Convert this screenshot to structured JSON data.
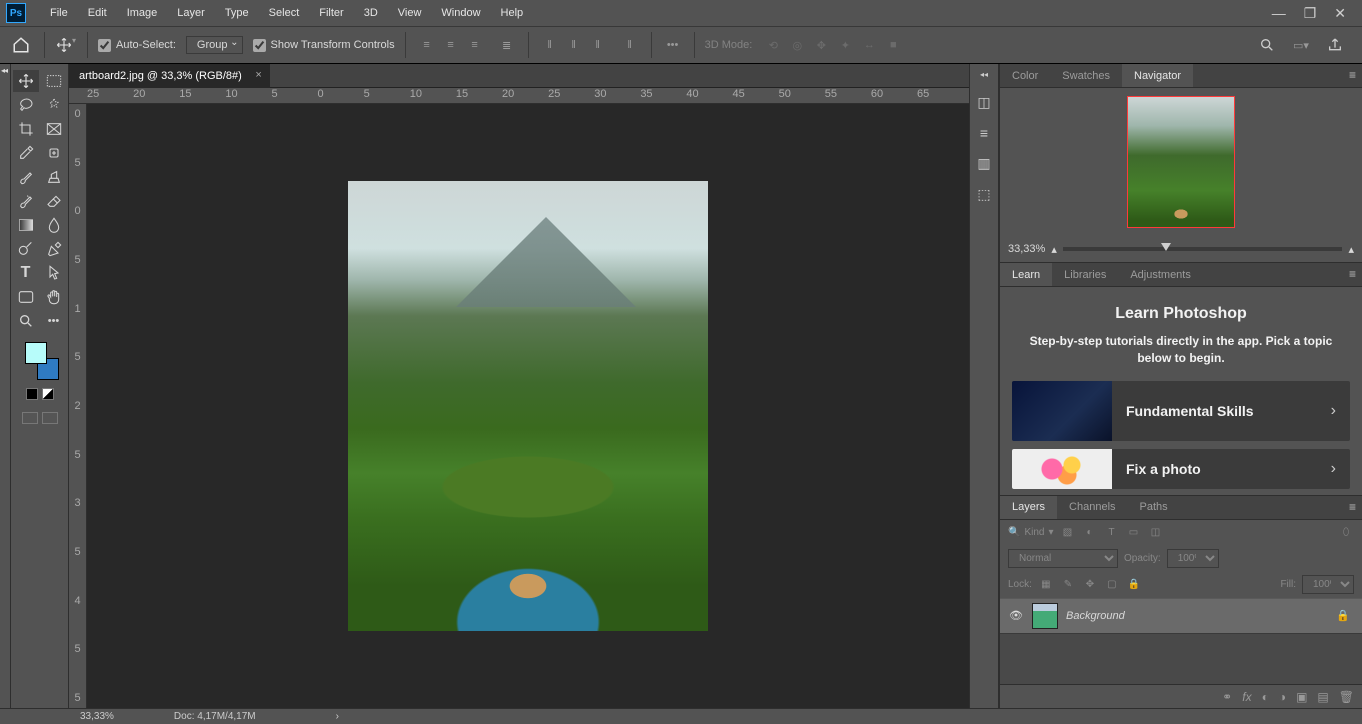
{
  "menubar": {
    "items": [
      "File",
      "Edit",
      "Image",
      "Layer",
      "Type",
      "Select",
      "Filter",
      "3D",
      "View",
      "Window",
      "Help"
    ]
  },
  "options": {
    "auto_select_label": "Auto-Select:",
    "auto_select_value": "Group",
    "show_transform_label": "Show Transform Controls",
    "mode3d_label": "3D Mode:"
  },
  "document": {
    "tab_title": "artboard2.jpg @ 33,3% (RGB/8#)",
    "ruler_h": [
      "25",
      "20",
      "15",
      "10",
      "5",
      "0",
      "5",
      "10",
      "15",
      "20",
      "25",
      "30",
      "35",
      "40",
      "45",
      "50",
      "55",
      "60",
      "65"
    ],
    "ruler_v": [
      "0",
      "5",
      "0",
      "5",
      "1",
      "5",
      "2",
      "5",
      "3",
      "5",
      "4",
      "5",
      "5"
    ]
  },
  "navigator": {
    "zoom_text": "33,33%"
  },
  "palette_tabs_top": [
    "Color",
    "Swatches",
    "Navigator"
  ],
  "palette_tabs_learn": [
    "Learn",
    "Libraries",
    "Adjustments"
  ],
  "learn": {
    "title": "Learn Photoshop",
    "subtitle": "Step-by-step tutorials directly in the app. Pick a topic below to begin.",
    "cards": [
      {
        "label": "Fundamental Skills"
      },
      {
        "label": "Fix a photo"
      }
    ]
  },
  "palette_tabs_layers": [
    "Layers",
    "Channels",
    "Paths"
  ],
  "layers": {
    "filter_kind_label": "Kind",
    "blend_mode": "Normal",
    "opacity_label": "Opacity:",
    "opacity_value": "100%",
    "lock_label": "Lock:",
    "fill_label": "Fill:",
    "fill_value": "100%",
    "items": [
      {
        "name": "Background"
      }
    ]
  },
  "status": {
    "zoom": "33,33%",
    "doc": "Doc: 4,17M/4,17M"
  },
  "colors": {
    "fg": "#b7fcfa",
    "bg": "#2f7bc2"
  }
}
